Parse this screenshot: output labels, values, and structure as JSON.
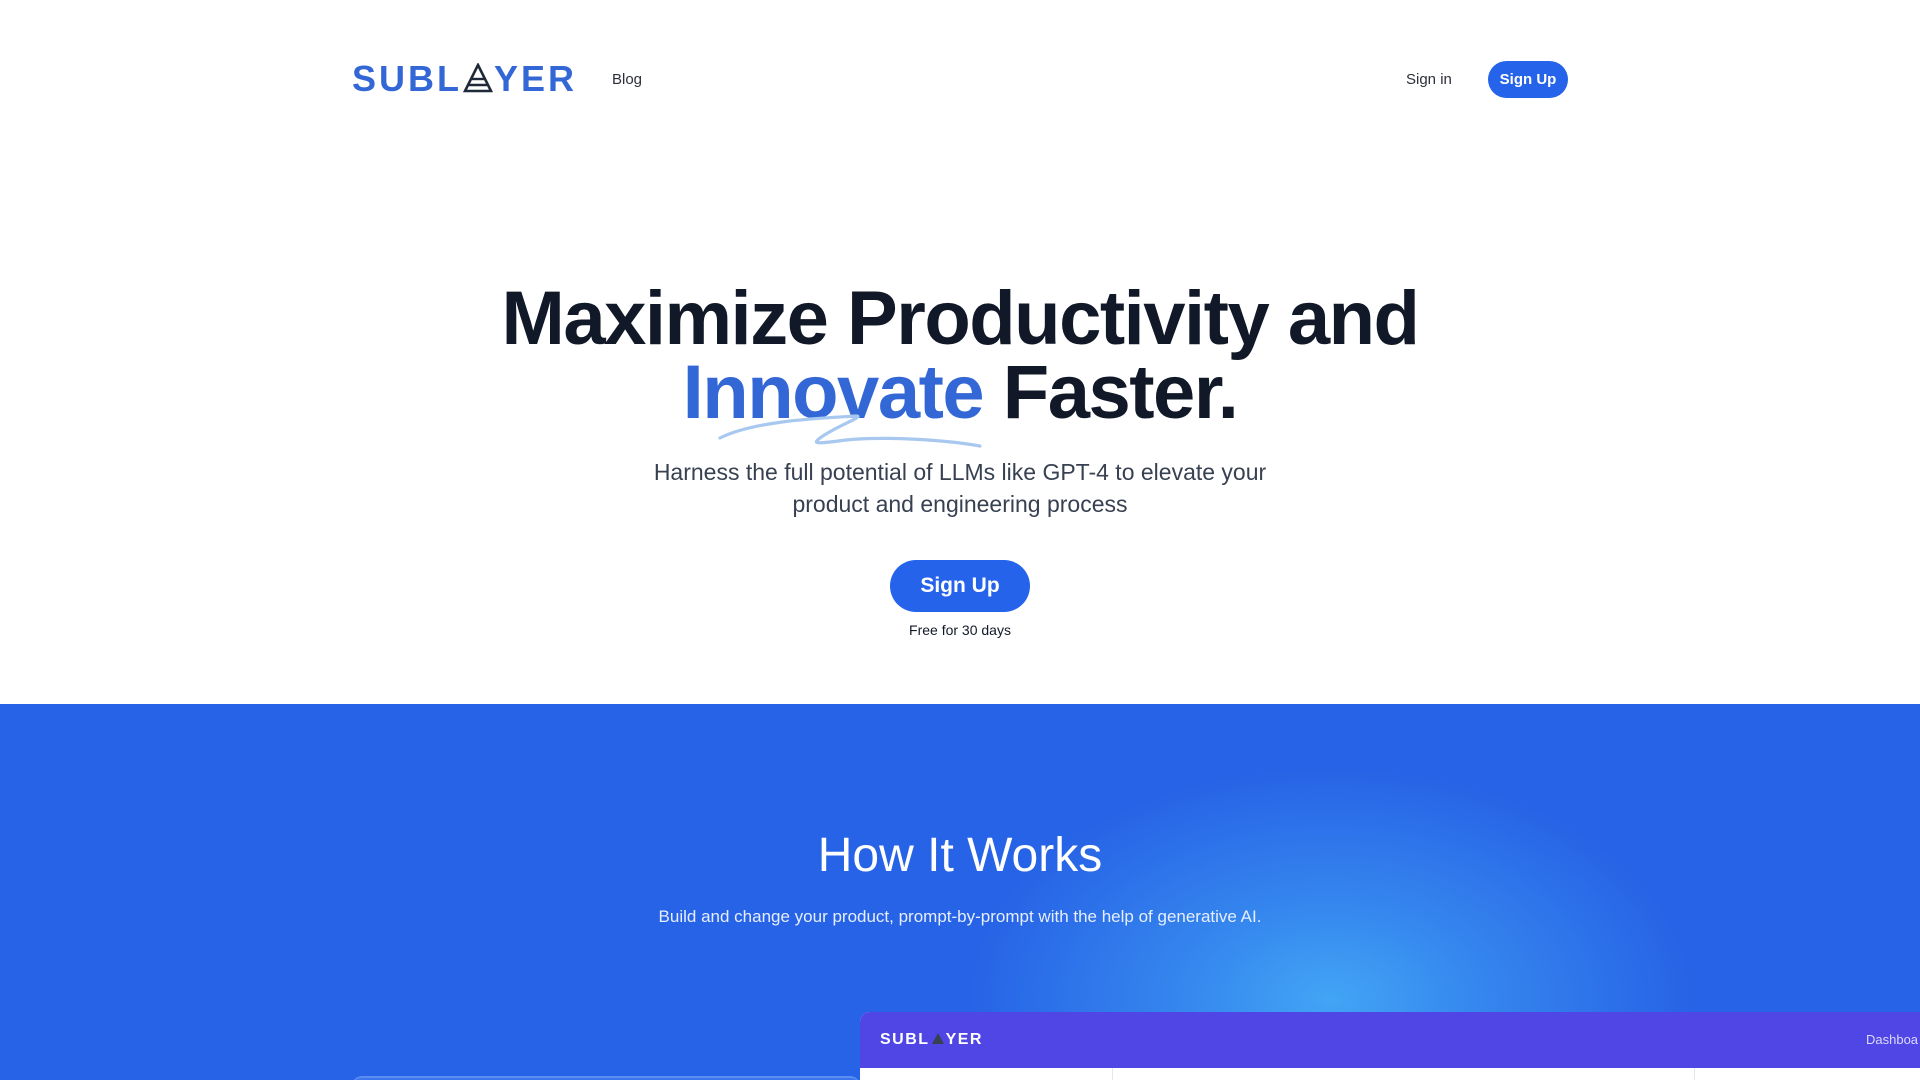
{
  "nav": {
    "logo_left": "SUBL",
    "logo_right": "YER",
    "blog_label": "Blog",
    "signin_label": "Sign in",
    "signup_label": "Sign Up"
  },
  "hero": {
    "title_line1": "Maximize Productivity and",
    "title_accent": "Innovate",
    "title_rest": " Faster.",
    "subtitle_line1": "Harness the full potential of LLMs like GPT-4 to elevate your",
    "subtitle_line2": "product and engineering process",
    "cta_label": "Sign Up",
    "cta_note": "Free for 30 days"
  },
  "how": {
    "title": "How It Works",
    "subtitle": "Build and change your product, prompt-by-prompt with the help of generative AI.",
    "preview_logo_left": "SUBL",
    "preview_logo_right": "YER",
    "preview_nav_label": "Dashboa"
  },
  "colors": {
    "brand": "#3467d6",
    "button": "#2563eb",
    "section_bg": "#2763e6",
    "preview_bar": "#4f46e5"
  }
}
